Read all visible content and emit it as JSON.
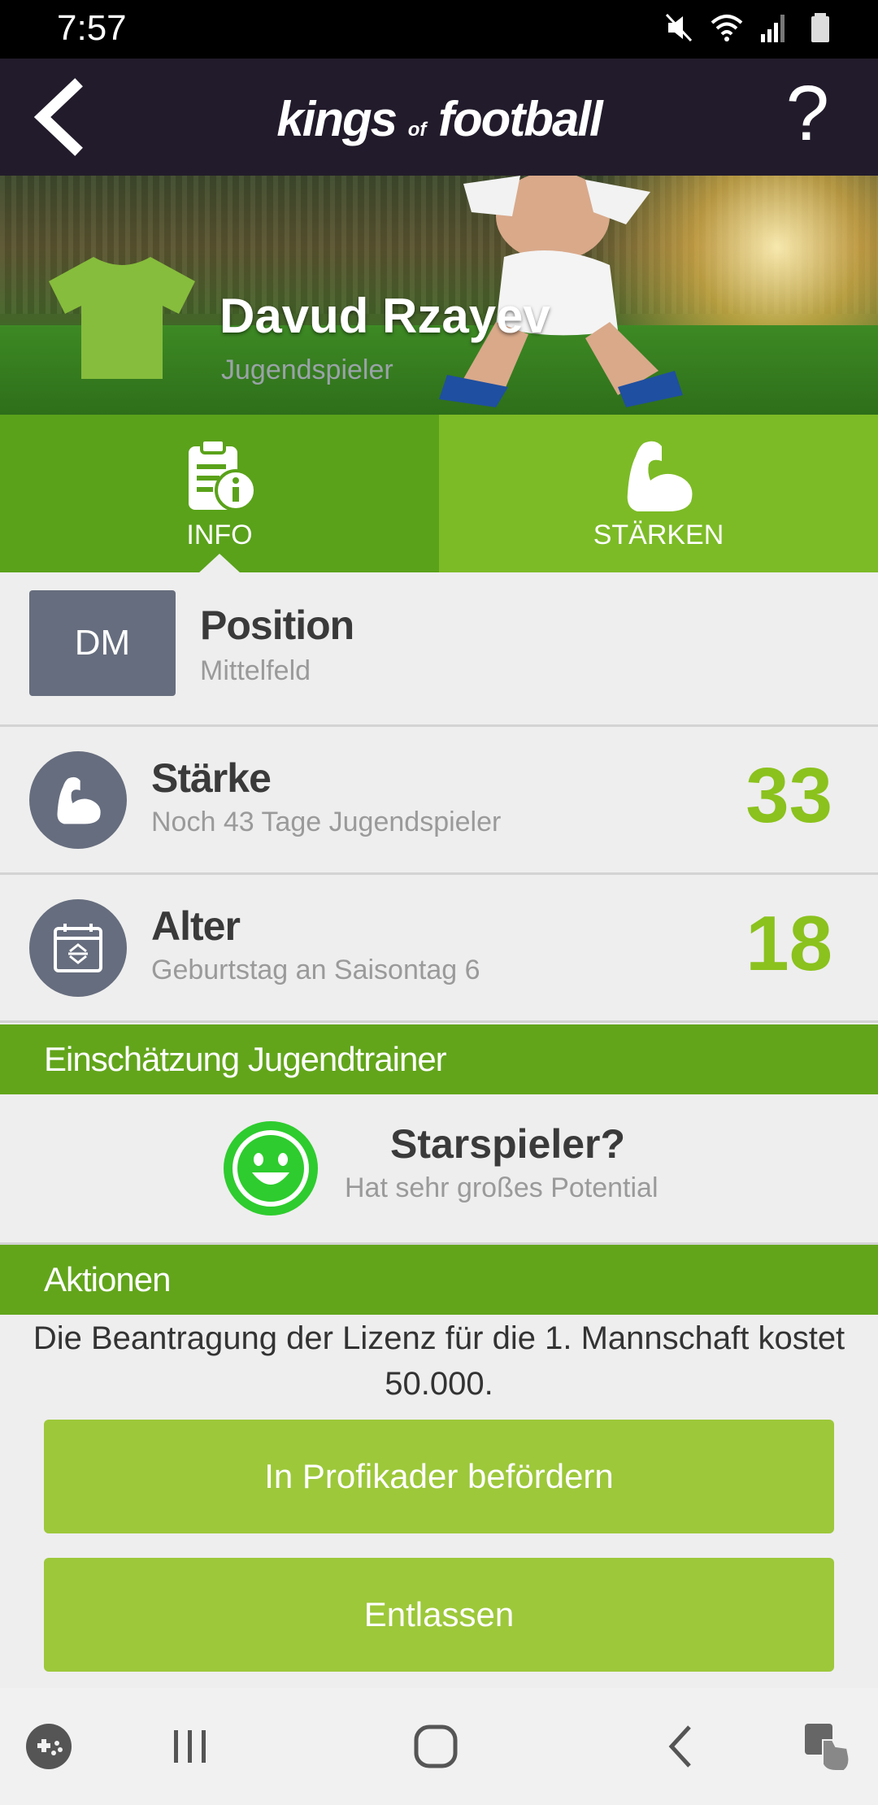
{
  "status_bar": {
    "time": "7:57"
  },
  "header": {
    "brand_main": "kings",
    "brand_of": "of",
    "brand_end": "football",
    "help": "?"
  },
  "player": {
    "name": "Davud Rzayev",
    "role": "Jugendspieler"
  },
  "tabs": [
    {
      "label": "INFO",
      "active": true
    },
    {
      "label": "STÄRKEN",
      "active": false
    }
  ],
  "position": {
    "badge": "DM",
    "title": "Position",
    "value": "Mittelfeld"
  },
  "strength": {
    "title": "Stärke",
    "subtitle": "Noch 43 Tage Jugendspieler",
    "value": "33"
  },
  "age": {
    "title": "Alter",
    "subtitle": "Geburtstag an Saisontag 6",
    "value": "18"
  },
  "assessment": {
    "heading": "Einschätzung Jugendtrainer",
    "title": "Starspieler?",
    "subtitle": "Hat sehr großes Potential"
  },
  "actions": {
    "heading": "Aktionen",
    "note": "Die Beantragung der Lizenz für die 1. Mannschaft kostet 50.000.",
    "promote_label": "In Profikader befördern",
    "release_label": "Entlassen"
  },
  "colors": {
    "accent": "#62a51b",
    "accent_light": "#8bc21d",
    "button": "#9dc83a",
    "header_bg": "#221b2b",
    "badge_bg": "#666d7e"
  }
}
